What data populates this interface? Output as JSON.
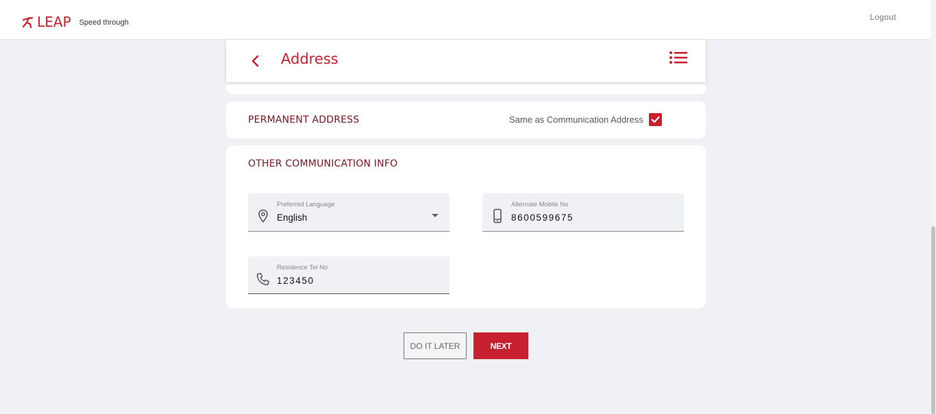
{
  "header": {
    "brand_name": "LEAP",
    "brand_tagline": "Speed through",
    "logout_label": "Logout"
  },
  "page": {
    "title": "Address"
  },
  "permanent_address": {
    "title": "PERMANENT ADDRESS",
    "same_as_label": "Same as Communication Address",
    "same_as_checked": true
  },
  "other_info": {
    "title": "OTHER COMMUNICATION INFO",
    "preferred_language": {
      "label": "Preferred Language",
      "value": "English"
    },
    "alternate_mobile": {
      "label": "Alternate Mobile No",
      "value": "8600599675"
    },
    "residence_tel": {
      "label": "Residence Tel No",
      "value": "123450"
    }
  },
  "actions": {
    "later_label": "DO IT LATER",
    "next_label": "NEXT"
  },
  "colors": {
    "brand_red": "#c8202f",
    "dark_red": "#7a1620",
    "background": "#f0f1f4"
  },
  "icons": {
    "brand": "runner-icon",
    "back": "chevron-left-icon",
    "menu": "list-icon",
    "language": "location-pin-icon",
    "mobile": "smartphone-icon",
    "tel": "phone-icon",
    "checkbox": "check-icon",
    "dropdown": "caret-down-icon"
  }
}
